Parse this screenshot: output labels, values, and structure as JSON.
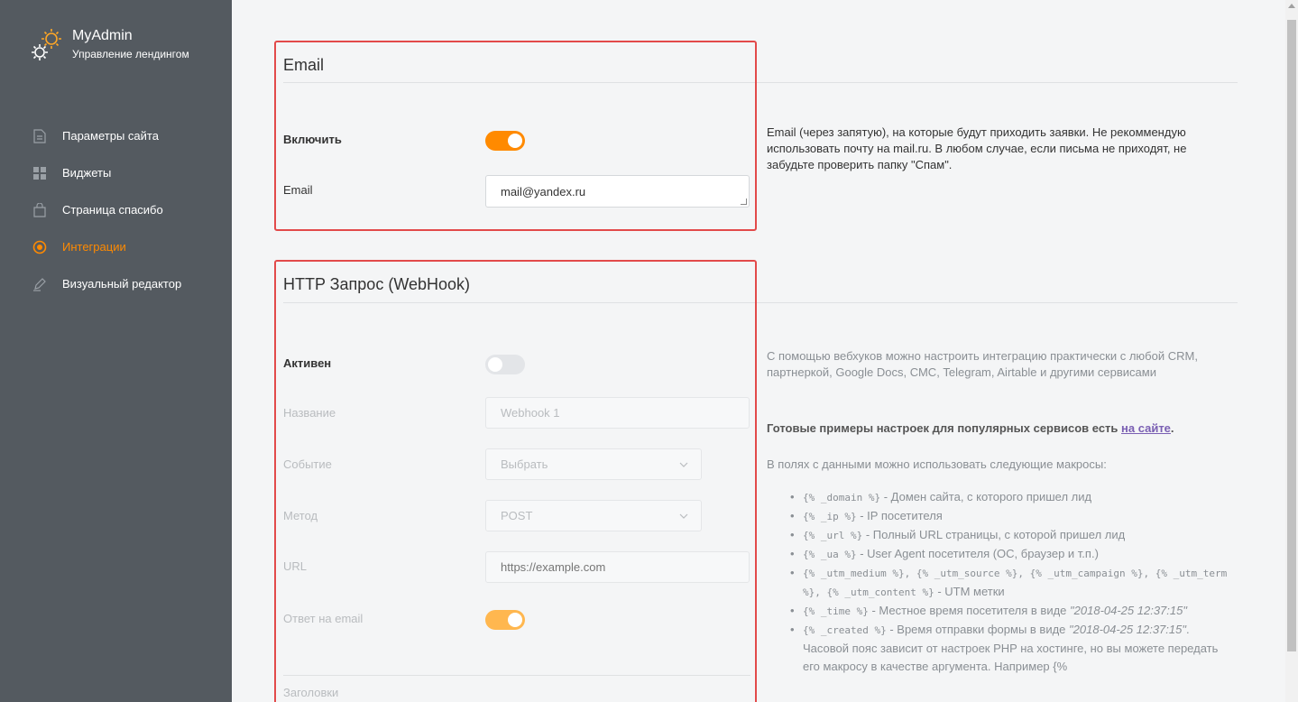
{
  "brand": {
    "name": "MyAdmin",
    "subtitle": "Управление лендингом",
    "icon": "gears-icon"
  },
  "nav": {
    "items": [
      {
        "label": "Параметры сайта",
        "icon": "document-icon"
      },
      {
        "label": "Виджеты",
        "icon": "grid-icon"
      },
      {
        "label": "Страница спасибо",
        "icon": "shopping-bag-icon"
      },
      {
        "label": "Интеграции",
        "icon": "integration-icon",
        "active": true
      },
      {
        "label": "Визуальный редактор",
        "icon": "pencil-icon"
      }
    ]
  },
  "email_section": {
    "title": "Email",
    "enable_label": "Включить",
    "enable_on": true,
    "email_label": "Email",
    "email_value": "mail@yandex.ru",
    "help": "Email (через запятую), на которые будут приходить заявки. Не рекоммендую использовать почту на mail.ru. В любом случае, если письма не приходят, не забудьте проверить папку \"Спам\"."
  },
  "webhook_section": {
    "title": "HTTP Запрос (WebHook)",
    "active_label": "Активен",
    "active_on": false,
    "name_label": "Название",
    "name_value": "Webhook 1",
    "event_label": "Событие",
    "event_value": "Выбрать",
    "method_label": "Метод",
    "method_value": "POST",
    "url_label": "URL",
    "url_placeholder": "https://example.com",
    "reply_label": "Ответ на email",
    "reply_on": true,
    "headers_label": "Заголовки",
    "help_intro": "С помощью вебхуков можно настроить интеграцию практически с любой CRM, партнеркой, Google Docs, СМС, Telegram, Airtable и другими сервисами",
    "help_examples_text": "Готовые примеры настроек для популярных сервисов есть ",
    "help_examples_link": "на сайте",
    "help_examples_end": ".",
    "help_macros_intro": "В полях с данными можно использовать следующие макросы:",
    "macros": [
      {
        "code": "{% _domain %}",
        "text": " - Домен сайта, с которого пришел лид"
      },
      {
        "code": "{% _ip %}",
        "text": " - IP посетителя"
      },
      {
        "code": "{% _url %}",
        "text": " - Полный URL страницы, с которой пришел лид"
      },
      {
        "code": "{% _ua %}",
        "text": " - User Agent посетителя (ОС, браузер и т.п.)"
      },
      {
        "code": "{% _utm_medium %}, {% _utm_source %}, {% _utm_campaign %}, {% _utm_term %}, {% _utm_content %}",
        "text": " - UTM метки"
      },
      {
        "code": "{% _time %}",
        "text": " - Местное время посетителя в виде ",
        "em": "\"2018-04-25 12:37:15\""
      },
      {
        "code": "{% _created %}",
        "text": " - Время отправки формы в виде ",
        "em": "\"2018-04-25 12:37:15\"",
        "tail": ". Часовой пояс зависит от настроек PHP на хостинге, но вы можете передать его макросу в качестве аргумента. Например {%"
      }
    ]
  },
  "colors": {
    "accent": "#ff8a00",
    "sidebar": "#545a60",
    "highlight": "#e24a4a"
  }
}
